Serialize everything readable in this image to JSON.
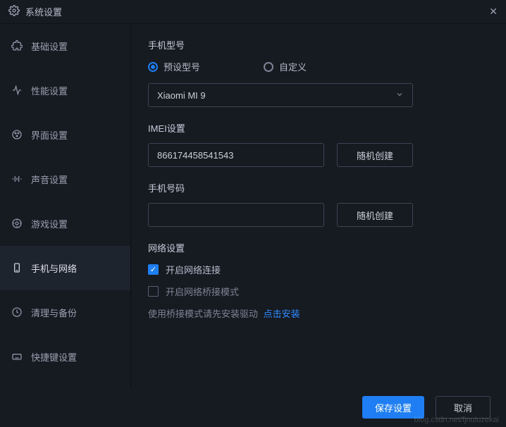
{
  "titlebar": {
    "title": "系统设置"
  },
  "sidebar": {
    "items": [
      {
        "label": "基础设置"
      },
      {
        "label": "性能设置"
      },
      {
        "label": "界面设置"
      },
      {
        "label": "声音设置"
      },
      {
        "label": "游戏设置"
      },
      {
        "label": "手机与网络"
      },
      {
        "label": "清理与备份"
      },
      {
        "label": "快捷键设置"
      }
    ]
  },
  "phone_model": {
    "label": "手机型号",
    "preset_label": "预设型号",
    "custom_label": "自定义",
    "selected": "Xiaomi MI 9"
  },
  "imei": {
    "label": "IMEI设置",
    "value": "866174458541543",
    "random_btn": "随机创建"
  },
  "phone_number": {
    "label": "手机号码",
    "value": "",
    "random_btn": "随机创建"
  },
  "network": {
    "label": "网络设置",
    "enable_label": "开启网络连接",
    "bridge_label": "开启网络桥接模式",
    "bridge_hint": "使用桥接模式请先安装驱动",
    "install_link": "点击安装"
  },
  "footer": {
    "save": "保存设置",
    "cancel": "取消"
  },
  "watermark": "blog.csdn.net/fjnuluzekai"
}
